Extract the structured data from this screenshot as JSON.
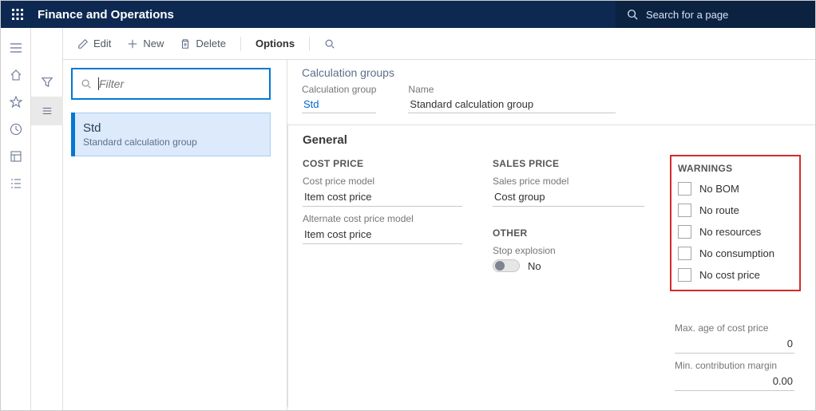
{
  "header": {
    "app_title": "Finance and Operations",
    "search_placeholder": "Search for a page"
  },
  "commandbar": {
    "edit": "Edit",
    "new": "New",
    "delete": "Delete",
    "options": "Options"
  },
  "listpanel": {
    "filter_placeholder": "Filter",
    "items": [
      {
        "title": "Std",
        "subtitle": "Standard calculation group"
      }
    ]
  },
  "detail": {
    "page_title": "Calculation groups",
    "head": {
      "group_label": "Calculation group",
      "group_value": "Std",
      "name_label": "Name",
      "name_value": "Standard calculation group"
    },
    "general": {
      "title": "General",
      "cost_price": {
        "section": "COST PRICE",
        "cost_price_model_label": "Cost price model",
        "cost_price_model_value": "Item cost price",
        "alt_model_label": "Alternate cost price model",
        "alt_model_value": "Item cost price"
      },
      "sales_price": {
        "section": "SALES PRICE",
        "model_label": "Sales price model",
        "model_value": "Cost group"
      },
      "other": {
        "section": "OTHER",
        "stop_label": "Stop explosion",
        "stop_value": "No"
      },
      "warnings": {
        "section": "WARNINGS",
        "items": [
          "No BOM",
          "No route",
          "No resources",
          "No consumption",
          "No cost price"
        ],
        "max_age_label": "Max. age of cost price",
        "max_age_value": "0",
        "min_margin_label": "Min. contribution margin",
        "min_margin_value": "0.00"
      }
    }
  }
}
